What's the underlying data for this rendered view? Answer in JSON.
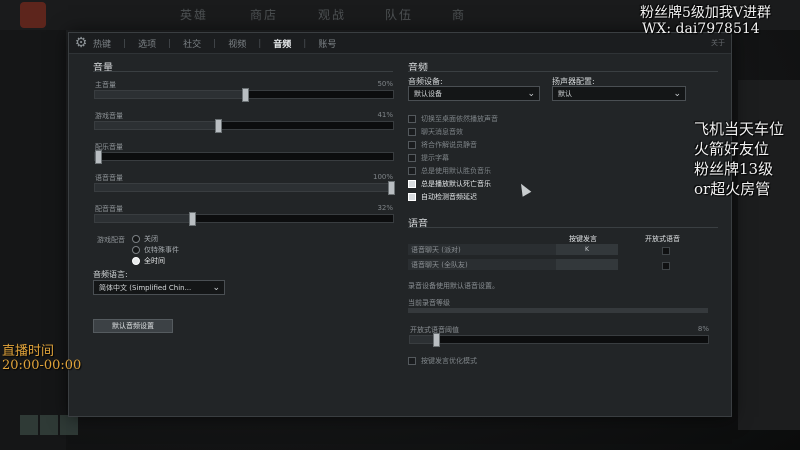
{
  "background": {
    "nav": [
      "英雄",
      "商店",
      "观战",
      "队伍",
      "商"
    ]
  },
  "tabs": [
    {
      "label": "热键",
      "active": false
    },
    {
      "label": "选项",
      "active": false
    },
    {
      "label": "社交",
      "active": false
    },
    {
      "label": "视频",
      "active": false
    },
    {
      "label": "音频",
      "active": true
    },
    {
      "label": "账号",
      "active": false
    }
  ],
  "about_label": "关于",
  "volume": {
    "title": "音量",
    "sliders": [
      {
        "label": "主音量",
        "value": "50%",
        "fraction": 0.5
      },
      {
        "label": "游戏音量",
        "value": "41%",
        "fraction": 0.41
      },
      {
        "label": "配乐音量",
        "value": "",
        "fraction": 0.0
      },
      {
        "label": "语音音量",
        "value": "100%",
        "fraction": 1.0
      },
      {
        "label": "配音音量",
        "value": "32%",
        "fraction": 0.32
      }
    ],
    "announcer": {
      "label": "游戏配音",
      "options": [
        {
          "label": "关闭",
          "selected": false
        },
        {
          "label": "仅特殊事件",
          "selected": false
        },
        {
          "label": "全时间",
          "selected": true
        }
      ]
    },
    "language": {
      "label": "音频语言:",
      "value": "简体中文 (Simplified Chin..."
    },
    "default_button": "默认音频设置"
  },
  "audio": {
    "title": "音频",
    "device_label": "音频设备:",
    "device_value": "默认设备",
    "speaker_label": "扬声器配置:",
    "speaker_value": "默认",
    "options": [
      {
        "label": "切换至桌面依然播放声音",
        "checked": false
      },
      {
        "label": "聊天消息音效",
        "checked": false
      },
      {
        "label": "将合作解说员静音",
        "checked": false
      },
      {
        "label": "提示字幕",
        "checked": false
      },
      {
        "label": "总是使用默认胜负音乐",
        "checked": false
      },
      {
        "label": "总是播放默认死亡音乐",
        "checked": true
      },
      {
        "label": "自动检测音频延迟",
        "checked": true
      }
    ]
  },
  "voice": {
    "title": "语音",
    "col_ptt": "按键发言",
    "col_open": "开放式语音",
    "rows": [
      {
        "label": "语音聊天 (派对)",
        "key": "K"
      },
      {
        "label": "语音聊天 (全队友)",
        "key": ""
      }
    ],
    "record_note": "录音设备使用默认语音设置。",
    "current_level_label": "当前录音等级",
    "threshold_label": "开放式语音阈值",
    "threshold_value": "8%",
    "threshold_fraction": 0.08,
    "ptt_optimize": "按键发言优化模式"
  },
  "overlays": {
    "top_right_1": "粉丝牌5级加我V进群",
    "top_right_2": "WX: dai7978514",
    "right_lines": [
      "飞机当天车位",
      "火箭好友位",
      "粉丝牌13级",
      "or超火房管"
    ],
    "live_label": "直播时间",
    "live_time": "20:00-00:00"
  }
}
